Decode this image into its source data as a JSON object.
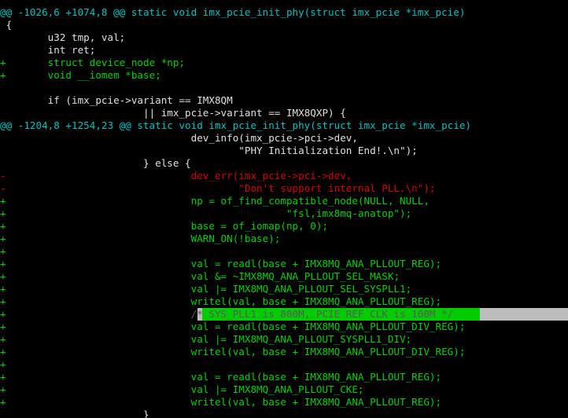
{
  "colors": {
    "background": "#000000",
    "hunk_header": "#00c0c0",
    "context": "#e0e0e0",
    "added": "#00d000",
    "removed": "#d00000",
    "trailing_whitespace": "#bdbdbd",
    "selection_green": "#00cc00"
  },
  "lines": [
    {
      "type": "hunk",
      "prefix": "",
      "code": "@@ -1026,6 +1074,8 @@ static void imx_pcie_init_phy(struct imx_pcie *imx_pcie)"
    },
    {
      "type": "ctx",
      "prefix": " ",
      "code": "{"
    },
    {
      "type": "ctx",
      "prefix": " ",
      "code": "       u32 tmp, val;"
    },
    {
      "type": "ctx",
      "prefix": " ",
      "code": "       int ret;"
    },
    {
      "type": "add",
      "prefix": "+",
      "code": "       struct device_node *np;"
    },
    {
      "type": "add",
      "prefix": "+",
      "code": "       void __iomem *base;"
    },
    {
      "type": "ctx",
      "prefix": " ",
      "code": ""
    },
    {
      "type": "ctx",
      "prefix": " ",
      "code": "       if (imx_pcie->variant == IMX8QM"
    },
    {
      "type": "ctx",
      "prefix": " ",
      "code": "                       || imx_pcie->variant == IMX8QXP) {"
    },
    {
      "type": "hunk",
      "prefix": "",
      "code": "@@ -1204,8 +1254,23 @@ static void imx_pcie_init_phy(struct imx_pcie *imx_pcie)"
    },
    {
      "type": "ctx",
      "prefix": " ",
      "code": "                               dev_info(imx_pcie->pci->dev,"
    },
    {
      "type": "ctx",
      "prefix": " ",
      "code": "                                       \"PHY Initialization End!.\\n\");"
    },
    {
      "type": "ctx",
      "prefix": " ",
      "code": "                       } else {"
    },
    {
      "type": "del",
      "prefix": "-",
      "code": "                               dev_err(imx_pcie->pci->dev,"
    },
    {
      "type": "del",
      "prefix": "-",
      "code": "                                       \"Don't support internal PLL.\\n\");"
    },
    {
      "type": "add",
      "prefix": "+",
      "code": "                               np = of_find_compatible_node(NULL, NULL,"
    },
    {
      "type": "add",
      "prefix": "+",
      "code": "                                               \"fsl,imx8mq-anatop\");"
    },
    {
      "type": "add",
      "prefix": "+",
      "code": "                               base = of_iomap(np, 0);"
    },
    {
      "type": "add",
      "prefix": "+",
      "code": "                               WARN_ON(!base);"
    },
    {
      "type": "add",
      "prefix": "+",
      "code": ""
    },
    {
      "type": "add",
      "prefix": "+",
      "code": "                               val = readl(base + IMX8MQ_ANA_PLLOUT_REG);"
    },
    {
      "type": "add",
      "prefix": "+",
      "code": "                               val &= ~IMX8MQ_ANA_PLLOUT_SEL_MASK;"
    },
    {
      "type": "add",
      "prefix": "+",
      "code": "                               val |= IMX8MQ_ANA_PLLOUT_SEL_SYSPLL1;"
    },
    {
      "type": "add",
      "prefix": "+",
      "code": "                               writel(val, base + IMX8MQ_ANA_PLLOUT_REG);"
    },
    {
      "type": "add",
      "prefix": "+",
      "code": "                               /* SYS_PLL1 is 800M, PCIE REF CLK is 100M */",
      "highlight": true
    },
    {
      "type": "add",
      "prefix": "+",
      "code": "                               val = readl(base + IMX8MQ_ANA_PLLOUT_DIV_REG);"
    },
    {
      "type": "add",
      "prefix": "+",
      "code": "                               val |= IMX8MQ_ANA_PLLOUT_SYSPLL1_DIV;"
    },
    {
      "type": "add",
      "prefix": "+",
      "code": "                               writel(val, base + IMX8MQ_ANA_PLLOUT_DIV_REG);"
    },
    {
      "type": "add",
      "prefix": "+",
      "code": ""
    },
    {
      "type": "add",
      "prefix": "+",
      "code": "                               val = readl(base + IMX8MQ_ANA_PLLOUT_REG);"
    },
    {
      "type": "add",
      "prefix": "+",
      "code": "                               val |= IMX8MQ_ANA_PLLOUT_CKE;"
    },
    {
      "type": "add",
      "prefix": "+",
      "code": "                               writel(val, base + IMX8MQ_ANA_PLLOUT_REG);"
    },
    {
      "type": "ctx",
      "prefix": " ",
      "code": "                       }"
    }
  ]
}
